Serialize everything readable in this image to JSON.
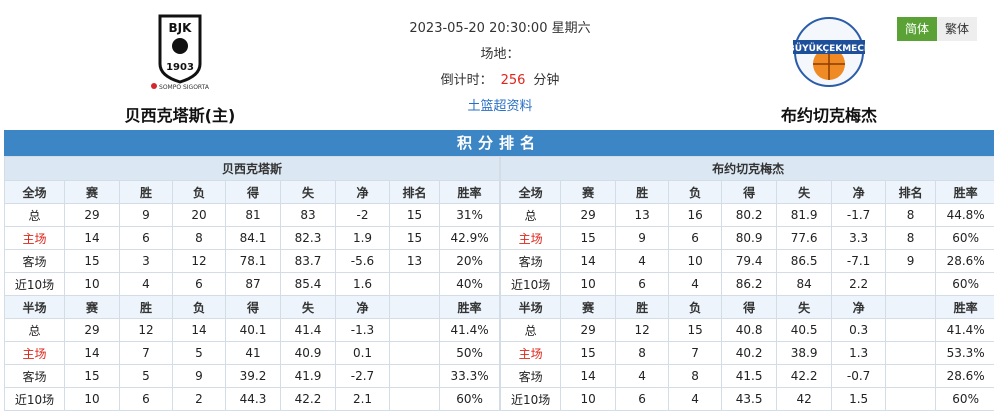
{
  "match": {
    "datetime": "2023-05-20 20:30:00 星期六",
    "venue_label": "场地：",
    "countdown_label": "倒计时：",
    "countdown_value": "256",
    "countdown_unit": "分钟",
    "data_link": "土篮超资料"
  },
  "home": {
    "name": "贝西克塔斯(主)",
    "logo_text": "BJK",
    "logo_year": "1903",
    "sponsor": "SOMPO SIGORTA"
  },
  "away": {
    "name": "布约切克梅杰",
    "logo_text": "BÜYÜKÇEKMECE"
  },
  "lang": {
    "simplified": "简体",
    "traditional": "繁体"
  },
  "standings": {
    "title": "积分排名",
    "full_cols": [
      "全场",
      "赛",
      "胜",
      "负",
      "得",
      "失",
      "净",
      "排名",
      "胜率"
    ],
    "half_cols": [
      "半场",
      "赛",
      "胜",
      "负",
      "得",
      "失",
      "净",
      "",
      "胜率"
    ],
    "home": {
      "team": "贝西克塔斯",
      "full": [
        [
          "总",
          "29",
          "9",
          "20",
          "81",
          "83",
          "-2",
          "15",
          "31%"
        ],
        [
          "主场",
          "14",
          "6",
          "8",
          "84.1",
          "82.3",
          "1.9",
          "15",
          "42.9%"
        ],
        [
          "客场",
          "15",
          "3",
          "12",
          "78.1",
          "83.7",
          "-5.6",
          "13",
          "20%"
        ],
        [
          "近10场",
          "10",
          "4",
          "6",
          "87",
          "85.4",
          "1.6",
          "",
          "40%"
        ]
      ],
      "half": [
        [
          "总",
          "29",
          "12",
          "14",
          "40.1",
          "41.4",
          "-1.3",
          "",
          "41.4%"
        ],
        [
          "主场",
          "14",
          "7",
          "5",
          "41",
          "40.9",
          "0.1",
          "",
          "50%"
        ],
        [
          "客场",
          "15",
          "5",
          "9",
          "39.2",
          "41.9",
          "-2.7",
          "",
          "33.3%"
        ],
        [
          "近10场",
          "10",
          "6",
          "2",
          "44.3",
          "42.2",
          "2.1",
          "",
          "60%"
        ]
      ]
    },
    "away": {
      "team": "布约切克梅杰",
      "full": [
        [
          "总",
          "29",
          "13",
          "16",
          "80.2",
          "81.9",
          "-1.7",
          "8",
          "44.8%"
        ],
        [
          "主场",
          "15",
          "9",
          "6",
          "80.9",
          "77.6",
          "3.3",
          "8",
          "60%"
        ],
        [
          "客场",
          "14",
          "4",
          "10",
          "79.4",
          "86.5",
          "-7.1",
          "9",
          "28.6%"
        ],
        [
          "近10场",
          "10",
          "6",
          "4",
          "86.2",
          "84",
          "2.2",
          "",
          "60%"
        ]
      ],
      "half": [
        [
          "总",
          "29",
          "12",
          "15",
          "40.8",
          "40.5",
          "0.3",
          "",
          "41.4%"
        ],
        [
          "主场",
          "15",
          "8",
          "7",
          "40.2",
          "38.9",
          "1.3",
          "",
          "53.3%"
        ],
        [
          "客场",
          "14",
          "4",
          "8",
          "41.5",
          "42.2",
          "-0.7",
          "",
          "28.6%"
        ],
        [
          "近10场",
          "10",
          "6",
          "4",
          "43.5",
          "42",
          "1.5",
          "",
          "60%"
        ]
      ]
    }
  },
  "colors": {
    "accent": "#3d86c6",
    "home_label": "#e0251a",
    "lang_active": "#5aa236"
  }
}
